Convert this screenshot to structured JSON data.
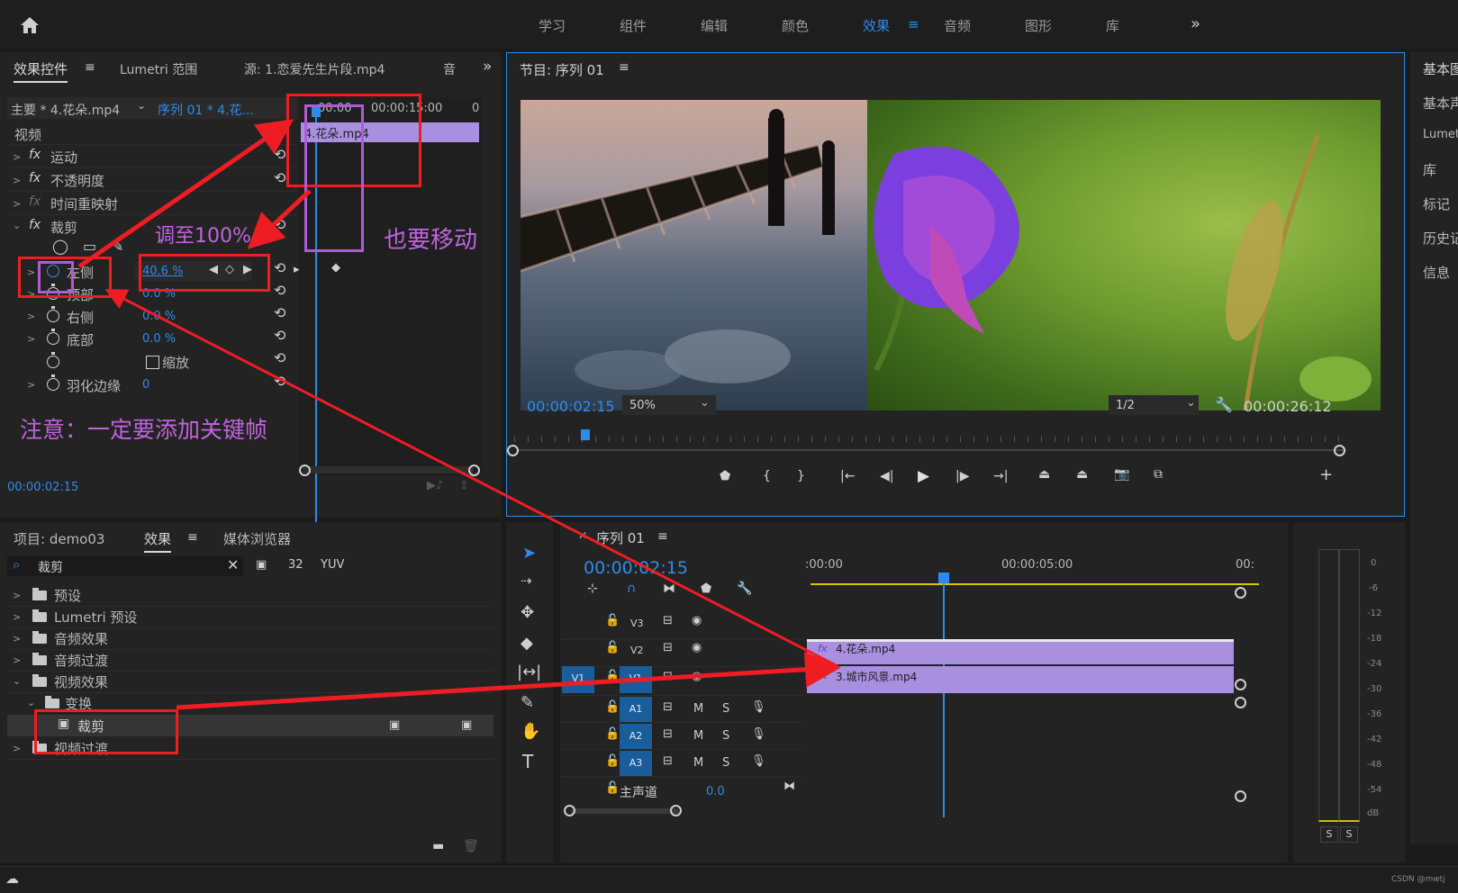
{
  "workspace": {
    "tabs": [
      "学习",
      "组件",
      "编辑",
      "颜色",
      "效果",
      "音频",
      "图形",
      "库"
    ],
    "active_tab": "效果",
    "more": "»"
  },
  "effect_controls": {
    "tab_effect": "效果控件",
    "tab_lumetri": "Lumetri 范围",
    "tab_source": "源: 1.恋爱先生片段.mp4",
    "tab_audio": "音",
    "expand": "»",
    "master": "主要 * 4.花朵.mp4",
    "sequence": "序列 01 * 4.花...",
    "ruler_start": "00:00",
    "ruler_mid": "00:00:15:00",
    "ruler_end": "0",
    "clip_label": "4.花朵.mp4",
    "section_video": "视频",
    "effects": [
      "运动",
      "不透明度",
      "时间重映射",
      "裁剪"
    ],
    "crop_params": [
      {
        "name": "左侧",
        "value": "40.6 %"
      },
      {
        "name": "顶部",
        "value": "0.0 %"
      },
      {
        "name": "右侧",
        "value": "0.0 %"
      },
      {
        "name": "底部",
        "value": "0.0 %"
      }
    ],
    "zoom_label": "缩放",
    "feather_label": "羽化边缘",
    "feather_value": "0",
    "timecode": "00:00:02:15"
  },
  "program": {
    "title": "节目: 序列 01",
    "timecode": "00:00:02:15",
    "zoom": "50%",
    "resolution": "1/2",
    "duration": "00:00:26:12"
  },
  "right_panel": {
    "items": [
      "基本图",
      "基本声",
      "Lumet",
      "库",
      "标记",
      "历史记",
      "信息"
    ]
  },
  "project": {
    "tab_project": "项目: demo03",
    "tab_effects": "效果",
    "tab_media": "媒体浏览器",
    "search": "裁剪",
    "tree": [
      {
        "label": "预设",
        "depth": 0,
        "open": false
      },
      {
        "label": "Lumetri 预设",
        "depth": 0,
        "open": false
      },
      {
        "label": "音频效果",
        "depth": 0,
        "open": false
      },
      {
        "label": "音频过渡",
        "depth": 0,
        "open": false
      },
      {
        "label": "视频效果",
        "depth": 0,
        "open": true
      },
      {
        "label": "变换",
        "depth": 1,
        "open": true
      },
      {
        "label": "裁剪",
        "depth": 2,
        "open": false
      },
      {
        "label": "视频过渡",
        "depth": 0,
        "open": false
      }
    ]
  },
  "timeline": {
    "title": "序列 01",
    "timecode": "00:00:02:15",
    "ruler": [
      ":00:00",
      "00:00:05:00",
      "00:"
    ],
    "tracks_video": [
      "V3",
      "V2",
      "V1"
    ],
    "tracks_audio": [
      "A1",
      "A2",
      "A3"
    ],
    "source_patch": "V1",
    "master_label": "主声道",
    "master_value": "0.0",
    "clip_v2": "4.花朵.mp4",
    "clip_v1": "3.城市风景.mp4",
    "fx_tag": "fx",
    "mute": "M",
    "solo": "S"
  },
  "meters": {
    "scale": [
      "0",
      "-6",
      "-12",
      "-18",
      "-24",
      "-30",
      "-36",
      "-42",
      "-48",
      "-54",
      "dB"
    ],
    "solo_left": "S",
    "solo_right": "S"
  },
  "annotations": {
    "set100": "调至100%",
    "also_move": "也要移动",
    "note": "注意：一定要添加关键帧"
  },
  "footer": {
    "credit": "CSDN @mwtj"
  },
  "colors": {
    "accent_blue": "#2d8ceb",
    "clip_purple": "#a88fe0",
    "annotation_red": "#ee1d24",
    "annotation_purple": "#b05ad6"
  }
}
